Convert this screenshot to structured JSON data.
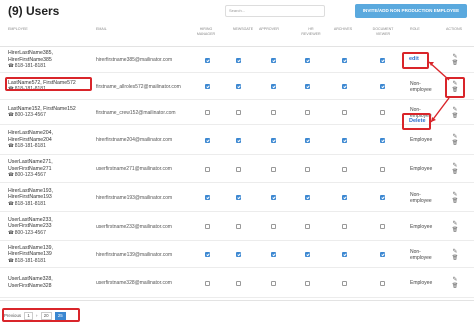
{
  "header": {
    "title": "(9) Users",
    "search_placeholder": "Search...",
    "invite_button": "INVITE/ADD NON PRODUCTION EMPLOYEE"
  },
  "columns": {
    "employee": "EMPLOYEE",
    "email": "EMAIL",
    "hiring_manager": "HIRING MANAGER",
    "newsgate": "NEWSGATE",
    "approver": "APPROVER",
    "hr_reviewer": "HR REVIEWER",
    "archives": "ARCHIVES",
    "document_viewer": "DOCUMENT VIEWER",
    "role": "ROLE",
    "actions": "ACTIONS"
  },
  "rows": [
    {
      "name": "HirerLastName385,",
      "name2": "HirerFirstName385",
      "phone": "818-181-8181",
      "email": "hirerfirstname385@mailinator.com",
      "perms": [
        true,
        true,
        true,
        true,
        true,
        true
      ],
      "role": ""
    },
    {
      "name": "LastName572, FirstName572",
      "name2": "",
      "phone": "818-181-8181",
      "email": "firstname_allroles572@mailinator.com",
      "perms": [
        true,
        true,
        true,
        true,
        true,
        true
      ],
      "role": "Non-employee"
    },
    {
      "name": "LastName152, FirstName152",
      "name2": "",
      "phone": "800-123-4567",
      "email": "firstname_crew152@mailinator.com",
      "perms": [
        false,
        false,
        false,
        false,
        false,
        false
      ],
      "role": "Non-employee"
    },
    {
      "name": "HirerLastName204,",
      "name2": "HirerFirstName204",
      "phone": "818-181-8181",
      "email": "hirerfirstname204@mailinator.com",
      "perms": [
        true,
        true,
        true,
        true,
        true,
        true
      ],
      "role": "Employee"
    },
    {
      "name": "UserLastName271,",
      "name2": "UserFirstName271",
      "phone": "800-123-4567",
      "email": "userfirstname271@mailinator.com",
      "perms": [
        false,
        false,
        false,
        false,
        false,
        false
      ],
      "role": "Employee"
    },
    {
      "name": "HirerLastName193,",
      "name2": "HirerFirstName193",
      "phone": "818-181-8181",
      "email": "hirerfirstname193@mailinator.com",
      "perms": [
        true,
        true,
        true,
        true,
        true,
        true
      ],
      "role": "Non-employee"
    },
    {
      "name": "UserLastName233,",
      "name2": "UserFirstName233",
      "phone": "800-123-4567",
      "email": "userfirstname233@mailinator.com",
      "perms": [
        false,
        false,
        false,
        false,
        false,
        false
      ],
      "role": "Employee"
    },
    {
      "name": "HirerLastName139,",
      "name2": "HirerFirstName139",
      "phone": "818-181-8181",
      "email": "hirerfirstname139@mailinator.com",
      "perms": [
        true,
        true,
        true,
        true,
        true,
        true
      ],
      "role": "Non-employee"
    },
    {
      "name": "UserLastName328,",
      "name2": "UserFirstName328",
      "phone": "",
      "email": "userfirstname328@mailinator.com",
      "perms": [
        false,
        false,
        false,
        false,
        false,
        false
      ],
      "role": "Employee"
    }
  ],
  "popup": {
    "edit_label": "edit",
    "delete_label": "Delete"
  },
  "pager": {
    "label": "Previous",
    "page": "1",
    "page_size": "20",
    "page_size_active": "25"
  },
  "colors": {
    "accent": "#3b87d1",
    "annotation": "#d9252a",
    "button": "#5aa9de"
  },
  "icons": {
    "phone": "phone-icon",
    "edit": "pencil-icon",
    "delete": "trash-icon"
  }
}
